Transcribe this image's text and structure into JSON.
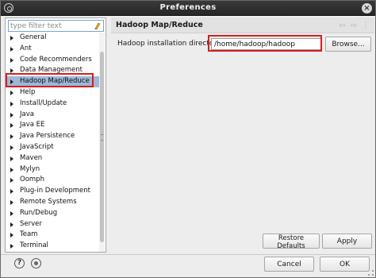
{
  "window": {
    "title": "Preferences"
  },
  "filter": {
    "placeholder": "type filter text"
  },
  "tree": {
    "items": [
      {
        "label": "General",
        "selected": false
      },
      {
        "label": "Ant",
        "selected": false
      },
      {
        "label": "Code Recommenders",
        "selected": false
      },
      {
        "label": "Data Management",
        "selected": false
      },
      {
        "label": "Hadoop Map/Reduce",
        "selected": true
      },
      {
        "label": "Help",
        "selected": false
      },
      {
        "label": "Install/Update",
        "selected": false
      },
      {
        "label": "Java",
        "selected": false
      },
      {
        "label": "Java EE",
        "selected": false
      },
      {
        "label": "Java Persistence",
        "selected": false
      },
      {
        "label": "JavaScript",
        "selected": false
      },
      {
        "label": "Maven",
        "selected": false
      },
      {
        "label": "Mylyn",
        "selected": false
      },
      {
        "label": "Oomph",
        "selected": false
      },
      {
        "label": "Plug-in Development",
        "selected": false
      },
      {
        "label": "Remote Systems",
        "selected": false
      },
      {
        "label": "Run/Debug",
        "selected": false
      },
      {
        "label": "Server",
        "selected": false
      },
      {
        "label": "Team",
        "selected": false
      },
      {
        "label": "Terminal",
        "selected": false
      }
    ]
  },
  "page": {
    "title": "Hadoop Map/Reduce",
    "install_dir_label": "Hadoop installation directory:",
    "install_dir_value": "/home/hadoop/hadoop",
    "browse_label": "Browse...",
    "restore_label": "Restore Defaults",
    "apply_label": "Apply"
  },
  "footer": {
    "cancel_label": "Cancel",
    "ok_label": "OK"
  },
  "colors": {
    "selection": "#9fb8d8",
    "highlight_box": "#d61e1e",
    "titlebar": "#2e2e2e"
  },
  "icons": [
    "app-icon",
    "close-icon",
    "clear-filter-icon",
    "back-arrow-icon",
    "forward-arrow-icon",
    "view-menu-icon",
    "help-icon",
    "record-macro-icon"
  ]
}
